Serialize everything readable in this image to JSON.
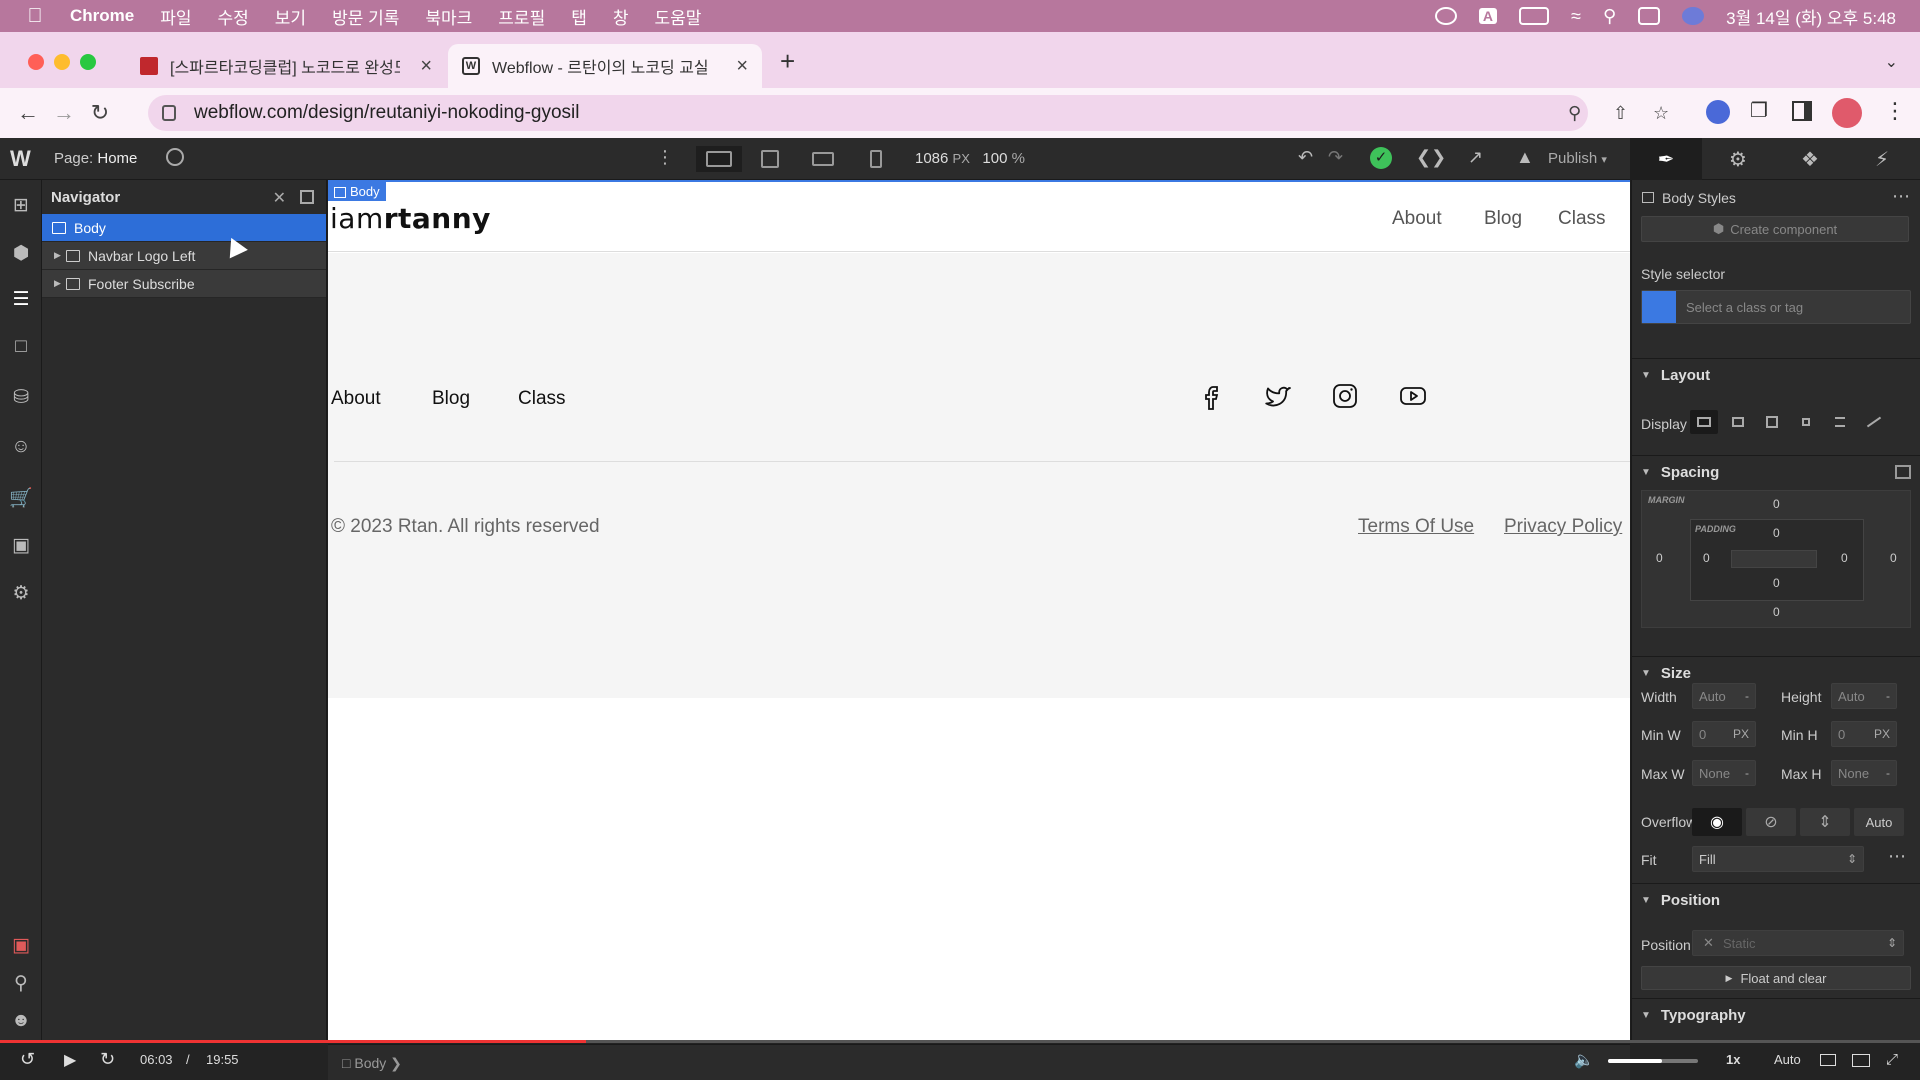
{
  "menubar": {
    "app": "Chrome",
    "items": [
      "파일",
      "수정",
      "보기",
      "방문 기록",
      "북마크",
      "프로필",
      "탭",
      "창",
      "도움말"
    ],
    "clock": "3월 14일 (화) 오후 5:48",
    "input_indicator": "A"
  },
  "tabs": [
    {
      "title": "[스파르타코딩클럽] 노코드로 완성도",
      "active": false
    },
    {
      "title": "Webflow - 르탄이의 노코딩 교실",
      "active": true
    }
  ],
  "address": {
    "url": "webflow.com/design/reutaniyi-nokoding-gyosil"
  },
  "wf_topbar": {
    "page_label": "Page:",
    "page_name": "Home",
    "width": "1086",
    "width_unit": "PX",
    "zoom": "100",
    "zoom_unit": "%",
    "publish": "Publish"
  },
  "navigator": {
    "title": "Navigator",
    "items": [
      {
        "label": "Body",
        "selected": true
      },
      {
        "label": "Navbar Logo Left",
        "selected": false
      },
      {
        "label": "Footer Subscribe",
        "selected": false
      }
    ]
  },
  "canvas": {
    "element_label": "Body",
    "logo_light": "iam",
    "logo_bold": "rtanny",
    "nav_links": [
      "About",
      "Blog",
      "Class"
    ],
    "footer_links": [
      "About",
      "Blog",
      "Class"
    ],
    "social_icons": [
      "facebook-icon",
      "twitter-icon",
      "instagram-icon",
      "youtube-icon"
    ],
    "copyright": "© 2023 Rtan. All rights reserved",
    "legal_links": [
      "Terms Of Use",
      "Privacy Policy"
    ]
  },
  "style_panel": {
    "title": "Body Styles",
    "create_component": "Create component",
    "style_selector_label": "Style selector",
    "selector_placeholder": "Select a class or tag",
    "layout": {
      "section": "Layout",
      "display_label": "Display"
    },
    "spacing": {
      "section": "Spacing",
      "margin_label": "MARGIN",
      "padding_label": "PADDING",
      "margin": {
        "top": "0",
        "right": "0",
        "bottom": "0",
        "left": "0"
      },
      "padding": {
        "top": "0",
        "right": "0",
        "bottom": "0",
        "left": "0"
      }
    },
    "size": {
      "section": "Size",
      "width_label": "Width",
      "width_value": "Auto",
      "height_label": "Height",
      "height_value": "Auto",
      "minw_label": "Min W",
      "minw_value": "0",
      "minw_unit": "PX",
      "minh_label": "Min H",
      "minh_value": "0",
      "minh_unit": "PX",
      "maxw_label": "Max W",
      "maxw_value": "None",
      "maxh_label": "Max H",
      "maxh_value": "None",
      "overflow_label": "Overflow",
      "overflow_auto": "Auto",
      "fit_label": "Fit",
      "fit_value": "Fill"
    },
    "position": {
      "section": "Position",
      "label": "Position",
      "value": "Static",
      "float_clear": "Float and clear"
    },
    "typography": {
      "section": "Typography"
    }
  },
  "video": {
    "current": "06:03",
    "separator": "/",
    "duration": "19:55",
    "progress": 0.305,
    "volume": 0.6,
    "speed": "1x",
    "quality": "Auto",
    "breadcrumb": "Body"
  },
  "colors": {
    "menubar": "#b7779d",
    "tabstrip": "#f1d6ec",
    "selection": "#2d6ed8",
    "webflow_blue": "#3b79e2",
    "publish_ok": "#3ec25a",
    "progress": "#ee3333"
  }
}
